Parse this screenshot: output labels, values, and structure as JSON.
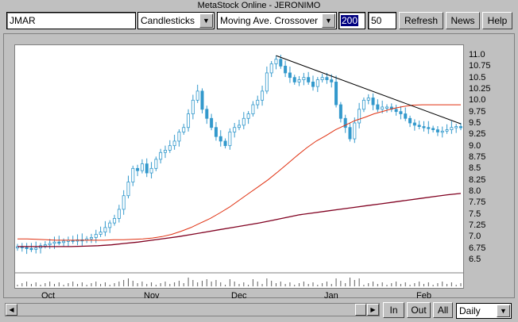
{
  "window": {
    "title": "MetaStock Online - JERONIMO"
  },
  "toolbar": {
    "symbol": "JMAR",
    "chart_style": "Candlesticks",
    "indicator": "Moving Ave. Crossover",
    "period_long": "200",
    "period_short": "50",
    "refresh_label": "Refresh",
    "news_label": "News",
    "help_label": "Help"
  },
  "bottom": {
    "in_label": "In",
    "out_label": "Out",
    "all_label": "All",
    "interval": "Daily"
  },
  "colors": {
    "candle": "#3399cc",
    "ma_short": "#e03010",
    "ma_long": "#800020",
    "trendline": "#000000"
  },
  "chart_data": {
    "type": "candlestick",
    "x_ticks": [
      "Oct",
      "Nov",
      "Dec",
      "Jan",
      "Feb"
    ],
    "y_ticks": [
      "11.0",
      "10.75",
      "10.5",
      "10.25",
      "10.0",
      "9.75",
      "9.5",
      "9.25",
      "9.0",
      "8.75",
      "8.5",
      "8.25",
      "8.0",
      "7.75",
      "7.5",
      "7.25",
      "7.0",
      "6.75",
      "6.5"
    ],
    "ylim": [
      6.5,
      11.0
    ],
    "close": [
      6.78,
      6.76,
      6.74,
      6.72,
      6.75,
      6.8,
      6.82,
      6.85,
      6.88,
      6.87,
      6.9,
      6.92,
      6.9,
      6.93,
      6.92,
      6.95,
      6.98,
      7.05,
      7.1,
      7.2,
      7.3,
      7.4,
      7.6,
      7.9,
      8.2,
      8.5,
      8.45,
      8.6,
      8.4,
      8.5,
      8.7,
      8.85,
      8.9,
      9.0,
      9.1,
      9.3,
      9.4,
      9.7,
      10.0,
      10.2,
      9.8,
      9.6,
      9.4,
      9.2,
      9.1,
      9.0,
      9.3,
      9.4,
      9.45,
      9.6,
      9.7,
      9.9,
      10.0,
      10.2,
      10.6,
      10.8,
      10.9,
      10.75,
      10.6,
      10.5,
      10.4,
      10.45,
      10.5,
      10.4,
      10.3,
      10.45,
      10.5,
      10.45,
      10.4,
      9.9,
      9.6,
      9.4,
      9.15,
      9.5,
      9.8,
      10.0,
      10.05,
      9.9,
      9.8,
      9.85,
      9.85,
      9.8,
      9.75,
      9.7,
      9.6,
      9.5,
      9.45,
      9.42,
      9.4,
      9.38,
      9.35,
      9.3,
      9.32,
      9.35,
      9.4,
      9.42,
      9.4
    ],
    "ma_short": [
      6.95,
      6.95,
      6.94,
      6.93,
      6.92,
      6.92,
      6.92,
      6.92,
      6.92,
      6.92,
      6.93,
      6.93,
      6.94,
      6.95,
      6.97,
      7.0,
      7.05,
      7.12,
      7.2,
      7.3,
      7.4,
      7.52,
      7.65,
      7.8,
      7.95,
      8.1,
      8.25,
      8.42,
      8.6,
      8.78,
      8.95,
      9.1,
      9.22,
      9.35,
      9.45,
      9.55,
      9.62,
      9.7,
      9.76,
      9.82,
      9.86,
      9.89,
      9.9,
      9.9,
      9.9,
      9.9,
      9.9
    ],
    "ma_long": [
      6.78,
      6.78,
      6.78,
      6.78,
      6.78,
      6.79,
      6.8,
      6.82,
      6.85,
      6.88,
      6.92,
      6.96,
      7.0,
      7.05,
      7.1,
      7.15,
      7.2,
      7.25,
      7.3,
      7.36,
      7.42,
      7.48,
      7.52,
      7.56,
      7.6,
      7.64,
      7.68,
      7.72,
      7.76,
      7.8,
      7.84,
      7.88,
      7.92,
      7.95
    ]
  }
}
